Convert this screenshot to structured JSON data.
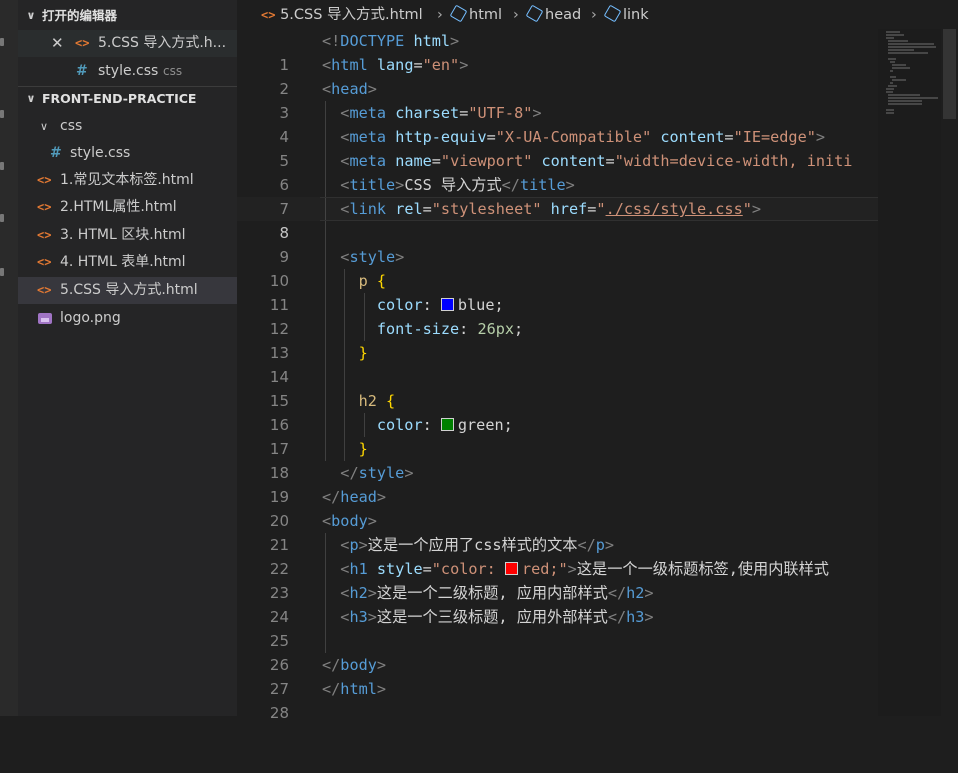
{
  "sidebar": {
    "open_editors": {
      "header": "打开的编辑器",
      "items": [
        {
          "name": "5.CSS 导入方式.h...",
          "type": "html"
        },
        {
          "name": "style.css",
          "dir": "css",
          "type": "css"
        }
      ]
    },
    "explorer": {
      "header": "FRONT-END-PRACTICE",
      "folder": "css",
      "folder_files": [
        "style.css"
      ],
      "files": [
        {
          "name": "1.常见文本标签.html",
          "type": "html"
        },
        {
          "name": "2.HTML属性.html",
          "type": "html"
        },
        {
          "name": "3. HTML 区块.html",
          "type": "html"
        },
        {
          "name": "4. HTML 表单.html",
          "type": "html"
        },
        {
          "name": "5.CSS 导入方式.html",
          "type": "html"
        },
        {
          "name": "logo.png",
          "type": "png"
        }
      ]
    }
  },
  "breadcrumb": [
    "5.CSS 导入方式.html",
    "html",
    "head",
    "link"
  ],
  "editor": {
    "current_line": 8,
    "line_numbers": [
      "1",
      "2",
      "3",
      "4",
      "5",
      "6",
      "7",
      "8",
      "9",
      "10",
      "11",
      "12",
      "13",
      "14",
      "15",
      "16",
      "17",
      "18",
      "19",
      "20",
      "21",
      "22",
      "23",
      "24",
      "25",
      "26",
      "27",
      "28"
    ],
    "code": {
      "l1": {
        "doctype": "DOCTYPE",
        "html": "html"
      },
      "l2": {
        "tag": "html",
        "attr": "lang",
        "val": "\"en\""
      },
      "l3": {
        "tag": "head"
      },
      "l4": {
        "tag": "meta",
        "attr": "charset",
        "val": "\"UTF-8\""
      },
      "l5": {
        "tag": "meta",
        "attr1": "http-equiv",
        "val1": "\"X-UA-Compatible\"",
        "attr2": "content",
        "val2": "\"IE=edge\""
      },
      "l6": {
        "tag": "meta",
        "attr1": "name",
        "val1": "\"viewport\"",
        "attr2": "content",
        "val2": "\"width=device-width, initi"
      },
      "l7": {
        "tag": "title",
        "text": "CSS 导入方式"
      },
      "l8": {
        "tag": "link",
        "attr1": "rel",
        "val1": "\"stylesheet\"",
        "attr2": "href",
        "q": "\"",
        "path": "./css/style.css",
        "q2": "\""
      },
      "l10": {
        "tag": "style"
      },
      "l11": {
        "selector": "p"
      },
      "l12": {
        "prop": "color",
        "value": "blue",
        "swatch": "#0000ff"
      },
      "l13": {
        "prop": "font-size",
        "num": "26px"
      },
      "l16": {
        "selector": "h2"
      },
      "l17": {
        "prop": "color",
        "value": "green",
        "swatch": "#008000"
      },
      "l19": {
        "tag": "style"
      },
      "l20": {
        "tag": "head"
      },
      "l21": {
        "tag": "body"
      },
      "l22": {
        "tag": "p",
        "text": "这是一个应用了css样式的文本"
      },
      "l23": {
        "tag": "h1",
        "attr": "style",
        "val_open": "\"color: ",
        "val_word": "red;\"",
        "swatch": "#ff0000",
        "text": "这是一个一级标题标签,使用内联样式"
      },
      "l24": {
        "tag": "h2",
        "text": "这是一个二级标题, 应用内部样式"
      },
      "l25": {
        "tag": "h3",
        "text": "这是一个三级标题, 应用外部样式"
      },
      "l27": {
        "tag": "body"
      },
      "l28": {
        "tag": "html"
      }
    }
  }
}
